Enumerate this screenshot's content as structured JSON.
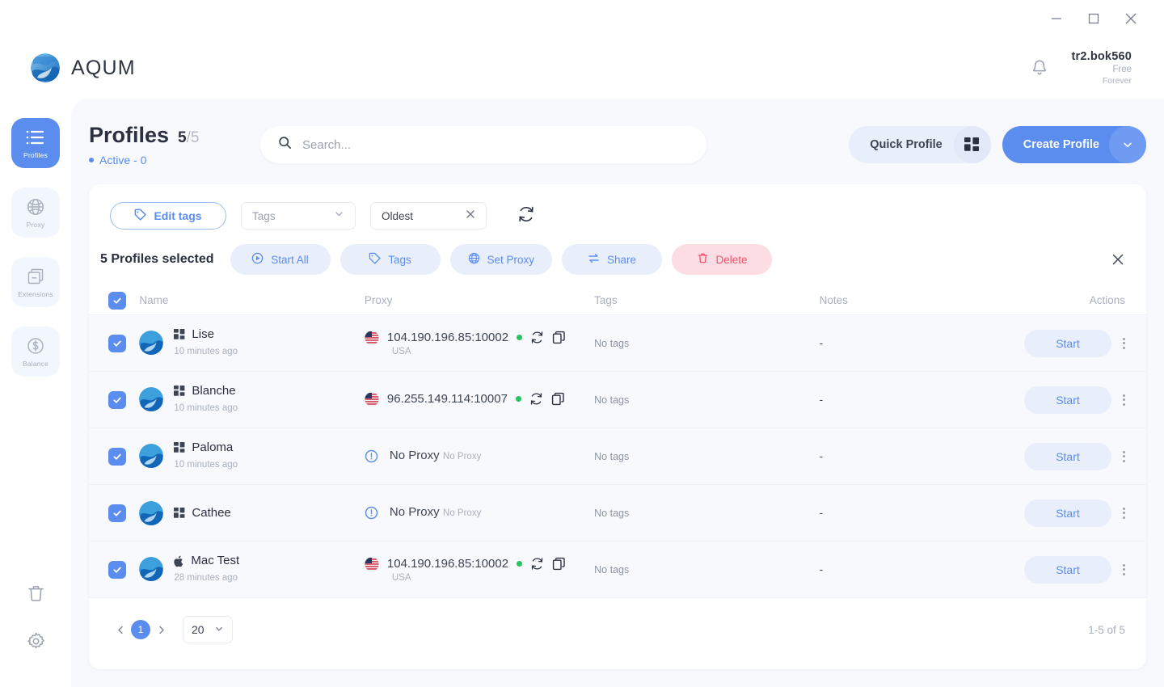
{
  "window": {
    "minimize": "minimize-icon",
    "maximize": "maximize-icon",
    "close": "close-icon"
  },
  "header": {
    "brand": "AQUM",
    "notifications_icon": "bell-icon",
    "user": {
      "name": "tr2.bok560",
      "plan": "Free",
      "plan_term": "Forever"
    }
  },
  "sidebar": {
    "items": [
      {
        "label": "Profiles",
        "icon": "list-icon",
        "active": true
      },
      {
        "label": "Proxy",
        "icon": "globe-icon",
        "active": false
      },
      {
        "label": "Extensions",
        "icon": "extensions-icon",
        "active": false
      },
      {
        "label": "Balance",
        "icon": "dollar-coin-icon",
        "active": false
      }
    ],
    "bottom": [
      {
        "label": "Trash",
        "icon": "trash-icon"
      },
      {
        "label": "Settings",
        "icon": "gear-icon"
      }
    ]
  },
  "page": {
    "title": "Profiles",
    "count_current": "5",
    "count_sep": "/",
    "count_total": "5",
    "active_status": "Active - 0"
  },
  "search": {
    "placeholder": "Search...",
    "value": "",
    "icon": "search-icon"
  },
  "toolbar": {
    "quick_profile_label": "Quick Profile",
    "quick_profile_icon": "windows-grid-icon",
    "create_profile_label": "Create Profile",
    "create_profile_caret": "chevron-down-icon"
  },
  "filters": {
    "edit_tags_label": "Edit tags",
    "edit_tags_icon": "tag-icon",
    "tags_placeholder": "Tags",
    "tags_caret": "chevron-down-icon",
    "sort_value": "Oldest",
    "sort_clear": "close-icon",
    "refresh_icon": "refresh-icon"
  },
  "selection": {
    "count_label": "5 Profiles selected",
    "actions": [
      {
        "label": "Start All",
        "icon": "play-circle-icon",
        "style": "normal"
      },
      {
        "label": "Tags",
        "icon": "tag-icon",
        "style": "normal"
      },
      {
        "label": "Set Proxy",
        "icon": "globe-icon",
        "style": "normal"
      },
      {
        "label": "Share",
        "icon": "share-icon",
        "style": "normal"
      },
      {
        "label": "Delete",
        "icon": "trash-icon",
        "style": "danger"
      }
    ],
    "close_icon": "close-icon"
  },
  "table": {
    "columns": [
      "Name",
      "Proxy",
      "Tags",
      "Notes",
      "Actions"
    ],
    "header_checkbox_checked": true,
    "rows": [
      {
        "checked": true,
        "os": "windows",
        "name": "Lise",
        "updated": "10 minutes ago",
        "proxy": "104.190.196.85:10002",
        "proxy_country": "USA",
        "proxy_status": "online",
        "has_proxy": true,
        "flag": "us",
        "tags": "No tags",
        "notes": "-",
        "action_label": "Start"
      },
      {
        "checked": true,
        "os": "windows",
        "name": "Blanche",
        "updated": "10 minutes ago",
        "proxy": "96.255.149.114:10007",
        "proxy_country": "",
        "proxy_status": "online",
        "has_proxy": true,
        "flag": "us",
        "tags": "No tags",
        "notes": "-",
        "action_label": "Start"
      },
      {
        "checked": true,
        "os": "windows",
        "name": "Paloma",
        "updated": "10 minutes ago",
        "proxy": "No Proxy",
        "proxy_country": "No Proxy",
        "proxy_status": "none",
        "has_proxy": false,
        "flag": "",
        "tags": "No tags",
        "notes": "-",
        "action_label": "Start"
      },
      {
        "checked": true,
        "os": "windows",
        "name": "Cathee",
        "updated": "",
        "proxy": "No Proxy",
        "proxy_country": "No Proxy",
        "proxy_status": "none",
        "has_proxy": false,
        "flag": "",
        "tags": "No tags",
        "notes": "-",
        "action_label": "Start"
      },
      {
        "checked": true,
        "os": "mac",
        "name": "Mac Test",
        "updated": "28 minutes ago",
        "proxy": "104.190.196.85:10002",
        "proxy_country": "USA",
        "proxy_status": "online",
        "has_proxy": true,
        "flag": "us",
        "tags": "No tags",
        "notes": "-",
        "action_label": "Start"
      }
    ]
  },
  "pagination": {
    "prev_icon": "chevron-left-icon",
    "next_icon": "chevron-right-icon",
    "current_page": "1",
    "page_size": "20",
    "page_size_caret": "chevron-down-icon",
    "range": "1-5 of 5"
  },
  "colors": {
    "accent": "#5b8def",
    "accent_soft": "#e9eefb",
    "danger": "#f2526f",
    "danger_soft": "#fcdde3",
    "online": "#22c55e",
    "panel_bg": "#f7f9fc",
    "text": "#2b3040",
    "muted": "#a9b0bd"
  }
}
